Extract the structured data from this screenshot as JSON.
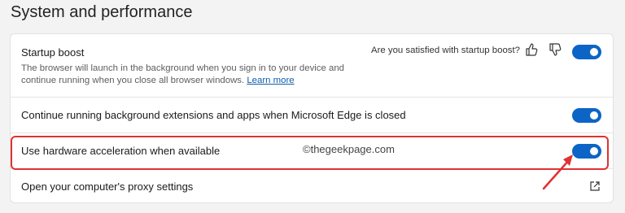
{
  "section": {
    "title": "System and performance"
  },
  "startup": {
    "label": "Startup boost",
    "description": "The browser will launch in the background when you sign in to your device and continue running when you close all browser windows.",
    "learn_more": "Learn more",
    "feedback_question": "Are you satisfied with startup boost?",
    "thumbs_up_icon": "thumbs-up-icon",
    "thumbs_down_icon": "thumbs-down-icon",
    "enabled": true
  },
  "background": {
    "label": "Continue running background extensions and apps when Microsoft Edge is closed",
    "enabled": true
  },
  "hardware": {
    "label": "Use hardware acceleration when available",
    "enabled": true
  },
  "proxy": {
    "label": "Open your computer's proxy settings",
    "icon": "external-link-icon"
  },
  "watermark": "©thegeekpage.com",
  "colors": {
    "accent": "#0c64c6",
    "highlight": "#e03131",
    "link": "#0b5cad",
    "background": "#f3f3f3",
    "card": "#ffffff"
  }
}
